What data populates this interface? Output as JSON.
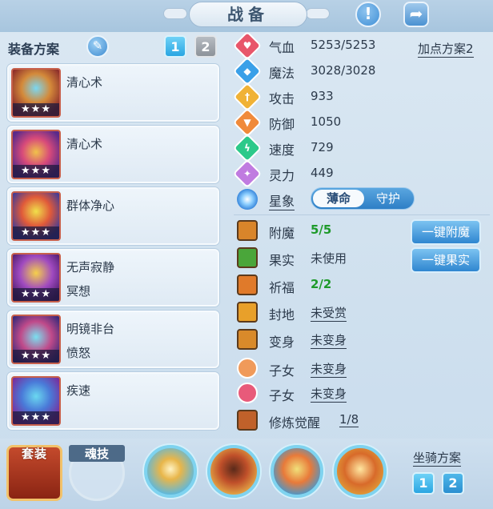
{
  "header": {
    "title": "战备",
    "info_icon": "exclamation-icon",
    "share_icon": "share-icon"
  },
  "equip_plan": {
    "label": "装备方案",
    "tabs": [
      "1",
      "2"
    ],
    "active_tab": "1"
  },
  "skills": [
    {
      "name": "清心术",
      "sub": "",
      "stars": "★★★"
    },
    {
      "name": "清心术",
      "sub": "",
      "stars": "★★★"
    },
    {
      "name": "群体净心",
      "sub": "",
      "stars": "★★★"
    },
    {
      "name": "无声寂静",
      "sub": "冥想",
      "stars": "★★★"
    },
    {
      "name": "明镜非台",
      "sub": "愤怒",
      "stars": "★★★"
    },
    {
      "name": "疾速",
      "sub": "",
      "stars": "★★★"
    }
  ],
  "stats": {
    "plan_link": "加点方案2",
    "rows": [
      {
        "label": "气血",
        "value": "5253/5253",
        "color": "#e8566a",
        "icon": "heart-icon"
      },
      {
        "label": "魔法",
        "value": "3028/3028",
        "color": "#3aa0e8",
        "icon": "mana-icon"
      },
      {
        "label": "攻击",
        "value": "933",
        "color": "#f0b236",
        "icon": "sword-icon"
      },
      {
        "label": "防御",
        "value": "1050",
        "color": "#f08a3a",
        "icon": "shield-icon"
      },
      {
        "label": "速度",
        "value": "729",
        "color": "#2cc98a",
        "icon": "lightning-icon"
      },
      {
        "label": "灵力",
        "value": "449",
        "color": "#c07be0",
        "icon": "spirit-icon"
      }
    ]
  },
  "star_sign": {
    "label": "星象",
    "option_a": "薄命",
    "option_b": "守护",
    "selected": "薄命"
  },
  "enhancements": [
    {
      "label": "附魔",
      "value": "5/5",
      "style": "green",
      "color": "#d9852a"
    },
    {
      "label": "果实",
      "value": "未使用",
      "style": "plain",
      "color": "#4aa63a"
    },
    {
      "label": "祈福",
      "value": "2/2",
      "style": "green",
      "color": "#e07a2a"
    },
    {
      "label": "封地",
      "value": "未受赏",
      "style": "under",
      "color": "#e8a02a"
    },
    {
      "label": "变身",
      "value": "未变身",
      "style": "under",
      "color": "#d98a2a"
    },
    {
      "label": "子女",
      "value": "未变身",
      "style": "under",
      "color": "#f09a5a"
    },
    {
      "label": "子女",
      "value": "未变身",
      "style": "under",
      "color": "#e85a7a"
    },
    {
      "label": "修炼觉醒",
      "value": "1/8",
      "style": "under",
      "color": "#c0612a"
    }
  ],
  "actions": {
    "enchant_button": "一键附魔",
    "fruit_button": "一键果实"
  },
  "bottom": {
    "set_label": "套装",
    "soul_label": "魂技",
    "mount_label": "坐骑方案",
    "mount_tabs": [
      "1",
      "2"
    ]
  }
}
